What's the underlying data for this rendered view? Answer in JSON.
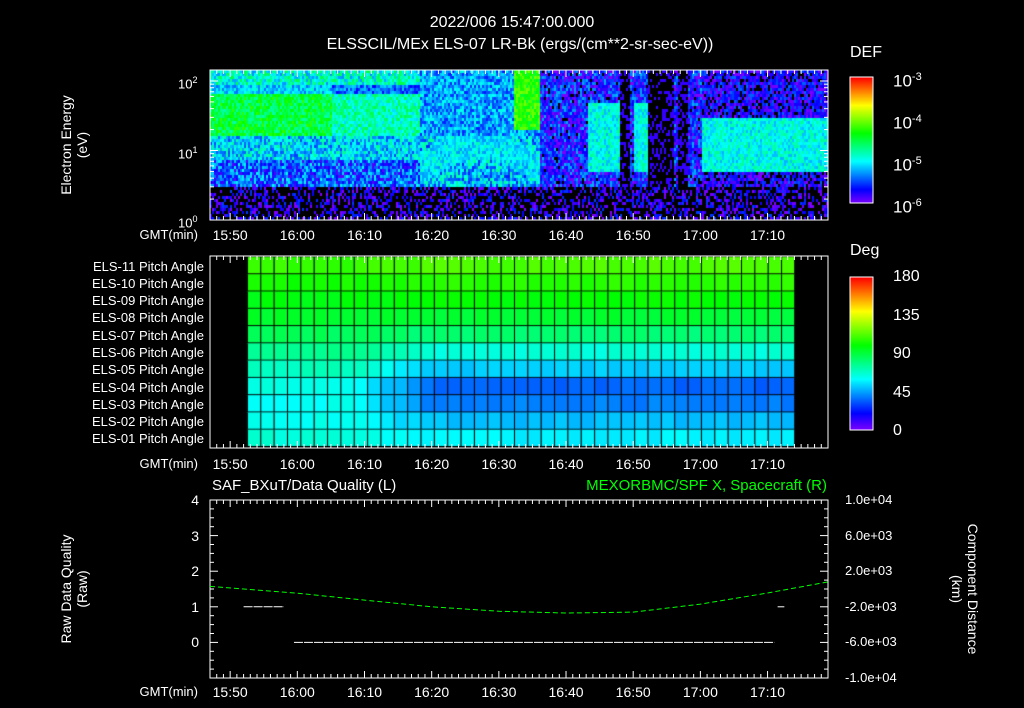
{
  "header": {
    "datetime": "2022/006 15:47:00.000",
    "title": "ELSSCIL/MEx ELS-07 LR-Bk  (ergs/(cm**2-sr-sec-eV))"
  },
  "chart_data": [
    {
      "type": "heatmap",
      "name": "electron-energy-spectrogram",
      "title": "ELSSCIL/MEx ELS-07 LR-Bk  (ergs/(cm**2-sr-sec-eV))",
      "ylabel": [
        "Electron Energy",
        "(eV)"
      ],
      "xlabel": "GMT(min)",
      "x_range": [
        "15:47",
        "17:19"
      ],
      "ylim": [
        1,
        144
      ],
      "yscale": "log",
      "y_ticks": [
        {
          "base": "10",
          "exp": "0",
          "value": 1
        },
        {
          "base": "10",
          "exp": "1",
          "value": 10
        },
        {
          "base": "10",
          "exp": "2",
          "value": 100
        }
      ],
      "colorbar": {
        "label": "DEF",
        "scale": "log",
        "range": [
          1e-06,
          0.001
        ],
        "ticks": [
          {
            "base": "10",
            "exp": "-3"
          },
          {
            "base": "10",
            "exp": "-4"
          },
          {
            "base": "10",
            "exp": "-5"
          },
          {
            "base": "10",
            "exp": "-6"
          }
        ]
      }
    },
    {
      "type": "heatmap",
      "name": "pitch-angle-grid",
      "xlabel": "GMT(min)",
      "data_range": [
        "15:52",
        "17:14"
      ],
      "rows": [
        {
          "label": "ELS-11 Pitch Angle",
          "early_deg": 108,
          "late_deg": 112
        },
        {
          "label": "ELS-10 Pitch Angle",
          "early_deg": 103,
          "late_deg": 106
        },
        {
          "label": "ELS-09 Pitch Angle",
          "early_deg": 98,
          "late_deg": 100
        },
        {
          "label": "ELS-08 Pitch Angle",
          "early_deg": 93,
          "late_deg": 92
        },
        {
          "label": "ELS-07 Pitch Angle",
          "early_deg": 86,
          "late_deg": 82
        },
        {
          "label": "ELS-06 Pitch Angle",
          "early_deg": 78,
          "late_deg": 66
        },
        {
          "label": "ELS-05 Pitch Angle",
          "early_deg": 70,
          "late_deg": 52
        },
        {
          "label": "ELS-04 Pitch Angle",
          "early_deg": 64,
          "late_deg": 36
        },
        {
          "label": "ELS-03 Pitch Angle",
          "early_deg": 62,
          "late_deg": 40
        },
        {
          "label": "ELS-02 Pitch Angle",
          "early_deg": 63,
          "late_deg": 50
        },
        {
          "label": "ELS-01 Pitch Angle",
          "early_deg": 66,
          "late_deg": 58
        }
      ],
      "colorbar": {
        "label": "Deg",
        "range": [
          0,
          180
        ],
        "ticks": [
          "180",
          "135",
          "90",
          "45",
          "0"
        ]
      }
    },
    {
      "type": "line",
      "name": "data-quality-and-position",
      "left_title": "SAF_BXuT/Data Quality (L)",
      "right_title": "MEXORBMC/SPF X, Spacecraft (R)",
      "ylabel_left": [
        "Raw Data Quality",
        "(Raw)"
      ],
      "ylabel_right": [
        "Component Distance",
        "(km)"
      ],
      "xlabel": "GMT(min)",
      "ylim_left": [
        -1,
        4
      ],
      "y_ticks_left": [
        "4",
        "3",
        "2",
        "1",
        "0"
      ],
      "ylim_right": [
        -10000,
        10000
      ],
      "y_ticks_right": [
        "1.0e+04",
        "6.0e+03",
        "2.0e+03",
        "-2.0e+03",
        "-6.0e+03",
        "-1.0e+04"
      ],
      "series": [
        {
          "name": "Data Quality",
          "color": "#ffffff",
          "segments": [
            {
              "from": "15:52",
              "to": "15:58",
              "value": 1
            },
            {
              "from": "15:59.5",
              "to": "17:11",
              "value": 0
            },
            {
              "from": "17:11.5",
              "to": "17:12.5",
              "value": 1
            }
          ]
        },
        {
          "name": "SPF X",
          "color": "#00ff00",
          "x": [
            "15:47",
            "16:00",
            "16:10",
            "16:20",
            "16:30",
            "16:40",
            "16:50",
            "17:00",
            "17:10",
            "17:19"
          ],
          "values": [
            300,
            -470,
            -1250,
            -2000,
            -2500,
            -2700,
            -2600,
            -1700,
            -450,
            800
          ]
        }
      ]
    }
  ],
  "time_ticks": [
    "15:50",
    "16:00",
    "16:10",
    "16:20",
    "16:30",
    "16:40",
    "16:50",
    "17:00",
    "17:10"
  ],
  "colors": {
    "background": "#000000",
    "axis": "#ffffff",
    "right_axis_title": "#00ff00"
  }
}
